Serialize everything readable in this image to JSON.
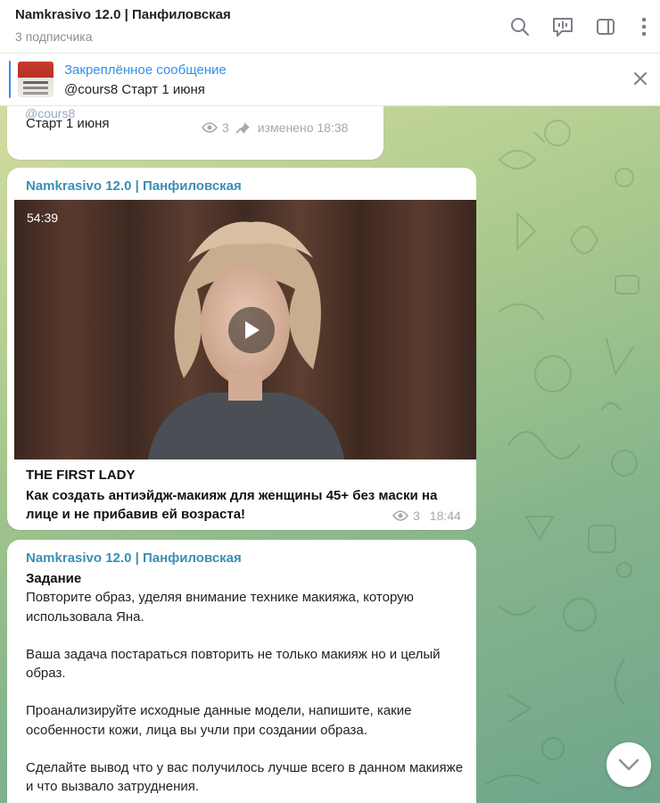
{
  "header": {
    "title": "Namkrasivo 12.0 | Панфиловская",
    "subtitle": "3 подписчика",
    "icons": [
      "search-icon",
      "video-chat-icon",
      "sidebar-icon",
      "more-icon"
    ]
  },
  "pinned": {
    "title": "Закреплённое сообщение",
    "text": "@cours8  Старт 1 июня"
  },
  "messages": {
    "m1": {
      "quote": "@cours8",
      "text": "Старт 1 июня",
      "views": "3",
      "edited": "изменено 18:38"
    },
    "m2": {
      "sender": "Namkrasivo 12.0 | Панфиловская",
      "duration": "54:39",
      "caption_title": "THE FIRST LADY",
      "caption_text": "Как создать антиэйдж-макияж для женщины 45+ без маски на лице и не прибавив ей возраста!",
      "views": "3",
      "time": "18:44"
    },
    "m3": {
      "sender": "Namkrasivo 12.0 | Панфиловская",
      "heading": "Задание",
      "p1": "Повторите образ, уделяя внимание технике макияжа, которую использовала Яна.",
      "p2": "Ваша задача постараться повторить не только макияж но и целый образ.",
      "p3": "Проанализируйте исходные данные модели, напишите, какие особенности кожи, лица вы учли при создании образа.",
      "p4": "Сделайте вывод что у вас получилось лучше всего в данном макияже и что вызвало затруднения."
    }
  },
  "colors": {
    "accent": "#3390ec",
    "sender": "#3a8fb7"
  }
}
